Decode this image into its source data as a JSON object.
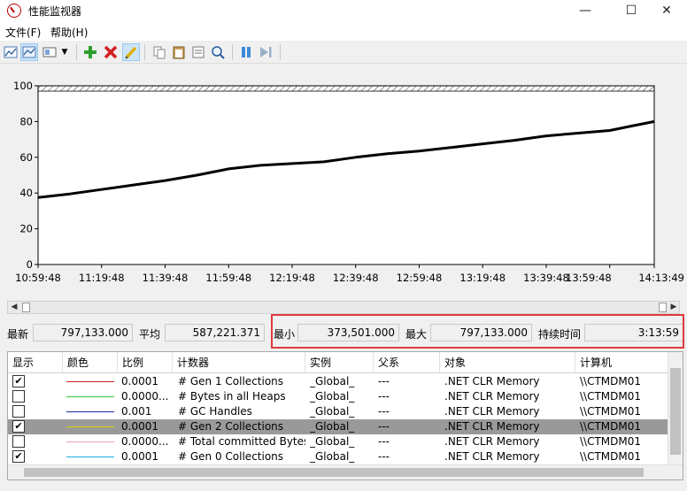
{
  "window": {
    "title": "性能监视器",
    "controls": {
      "minimize": "—",
      "maximize": "☐",
      "close": "✕"
    }
  },
  "menu": [
    {
      "label": "文件(F)"
    },
    {
      "label": "帮助(H)"
    }
  ],
  "toolbar": {
    "buttons": [
      "change-graph-type-icon",
      "view-current-activity-icon",
      "view-log-data-icon",
      "dropdown-icon",
      "add-icon",
      "delete-icon",
      "highlight-icon",
      "copy-properties-icon",
      "paste-counter-list-icon",
      "properties-icon",
      "zoom-icon",
      "freeze-display-icon",
      "update-data-icon"
    ]
  },
  "chart_data": {
    "type": "line",
    "title": "",
    "ylim": [
      0,
      100
    ],
    "yticks": [
      0,
      20,
      40,
      60,
      80,
      100
    ],
    "xticks": [
      "10:59:48",
      "11:19:48",
      "11:39:48",
      "11:59:48",
      "12:19:48",
      "12:39:48",
      "12:59:48",
      "13:19:48",
      "13:39:48",
      "13:59:48",
      "14:13:49"
    ],
    "grid": false,
    "series": [
      {
        "color": "#000000",
        "x": [
          "10:59:48",
          "11:09:48",
          "11:19:48",
          "11:29:48",
          "11:39:48",
          "11:49:48",
          "11:59:48",
          "12:09:48",
          "12:19:48",
          "12:29:48",
          "12:39:48",
          "12:49:48",
          "12:59:48",
          "13:09:48",
          "13:19:48",
          "13:29:48",
          "13:39:48",
          "13:49:48",
          "13:59:48",
          "14:06:48",
          "14:13:49"
        ],
        "y": [
          37.5,
          39.5,
          42,
          44.5,
          47,
          50,
          53.5,
          55.5,
          56.5,
          57.5,
          60,
          62,
          63.5,
          65.5,
          67.5,
          69.5,
          72,
          73.5,
          75,
          77.5,
          80
        ]
      }
    ]
  },
  "stats": {
    "latest_label": "最新",
    "latest_value": "797,133.000",
    "average_label": "平均",
    "average_value": "587,221.371",
    "min_label": "最小",
    "min_value": "373,501.000",
    "max_label": "最大",
    "max_value": "797,133.000",
    "duration_label": "持续时间",
    "duration_value": "3:13:59"
  },
  "table": {
    "headers": {
      "show": "显示",
      "color": "颜色",
      "scale": "比例",
      "counter": "计数器",
      "instance": "实例",
      "parent": "父系",
      "object": "对象",
      "computer": "计算机"
    },
    "rows": [
      {
        "checked": "✔",
        "color": "#d42020",
        "scale": "0.0001",
        "counter": "# Gen 1 Collections",
        "instance": "_Global_",
        "parent": "---",
        "object": ".NET CLR Memory",
        "computer": "\\\\CTMDM01"
      },
      {
        "checked": "",
        "color": "#2ecc40",
        "scale": "0.0000...",
        "counter": "# Bytes in all Heaps",
        "instance": "_Global_",
        "parent": "---",
        "object": ".NET CLR Memory",
        "computer": "\\\\CTMDM01"
      },
      {
        "checked": "",
        "color": "#1a2a9c",
        "scale": "0.001",
        "counter": "# GC Handles",
        "instance": "_Global_",
        "parent": "---",
        "object": ".NET CLR Memory",
        "computer": "\\\\CTMDM01"
      },
      {
        "checked": "✔",
        "color": "#d8d800",
        "scale": "0.0001",
        "counter": "# Gen 2 Collections",
        "instance": "_Global_",
        "parent": "---",
        "object": ".NET CLR Memory",
        "computer": "\\\\CTMDM01",
        "selected": true
      },
      {
        "checked": "",
        "color": "#f0a0b0",
        "scale": "0.0000...",
        "counter": "# Total committed Bytes",
        "instance": "_Global_",
        "parent": "---",
        "object": ".NET CLR Memory",
        "computer": "\\\\CTMDM01"
      },
      {
        "checked": "✔",
        "color": "#20b0e0",
        "scale": "0.0001",
        "counter": "# Gen 0 Collections",
        "instance": "_Global_",
        "parent": "---",
        "object": ".NET CLR Memory",
        "computer": "\\\\CTMDM01"
      }
    ]
  }
}
